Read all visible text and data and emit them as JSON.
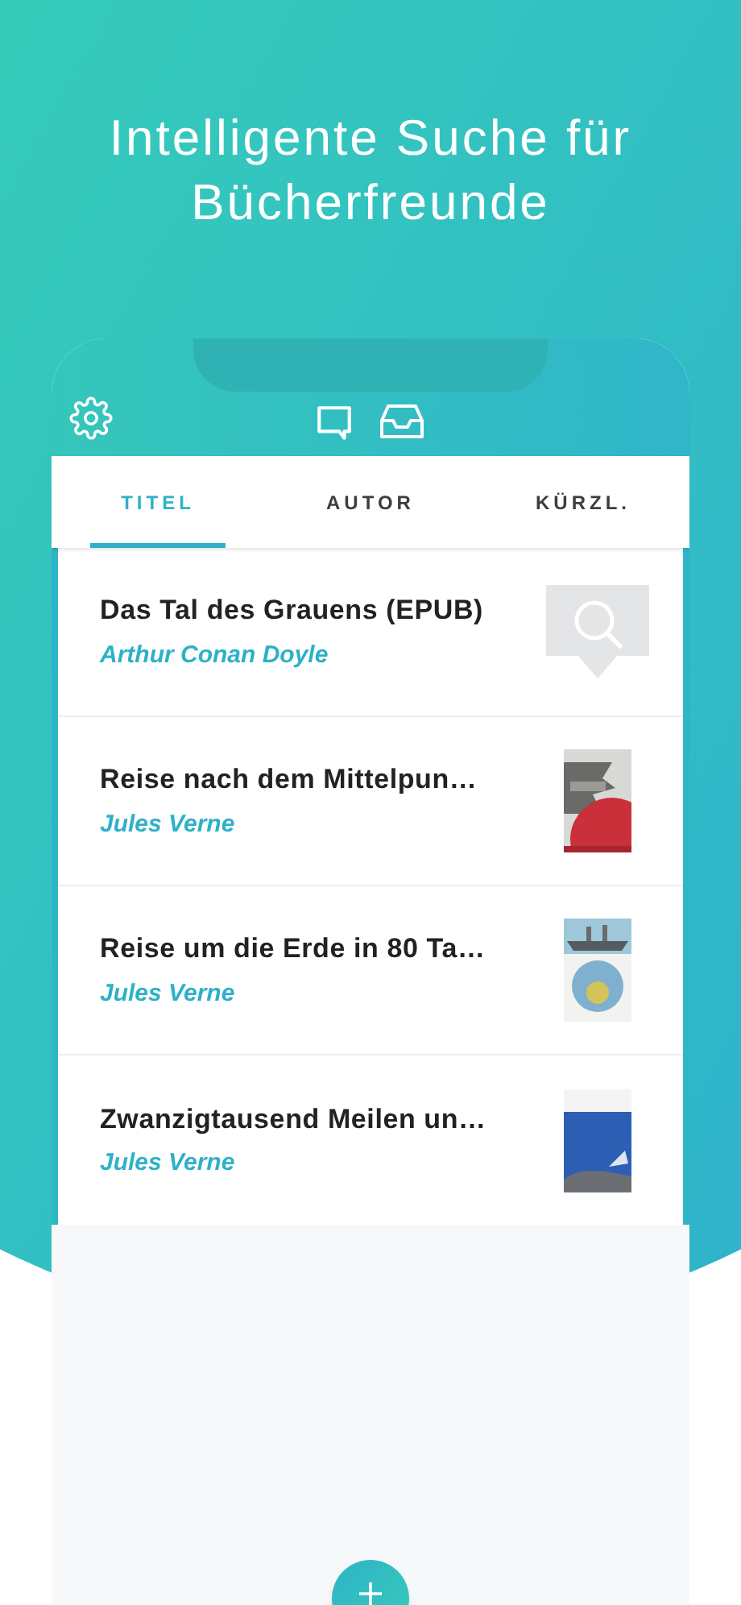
{
  "headline": "Intelligente Suche für Bücherfreunde",
  "tabs": [
    {
      "label": "TITEL",
      "selected": true
    },
    {
      "label": "AUTOR",
      "selected": false
    },
    {
      "label": "KÜRZL.",
      "selected": false
    }
  ],
  "books": [
    {
      "title": "Das Tal des Grauens (EPUB)",
      "author": "Arthur Conan Doyle",
      "kind": "placeholder"
    },
    {
      "title": "Reise nach dem Mittelpun…",
      "author": "Jules Verne",
      "kind": "picture"
    },
    {
      "title": "Reise um die Erde in 80 Ta…",
      "author": "Jules Verne",
      "kind": "picture"
    },
    {
      "title": "Zwanzigtausend Meilen un…",
      "author": "Jules Verne",
      "kind": "picture"
    }
  ]
}
